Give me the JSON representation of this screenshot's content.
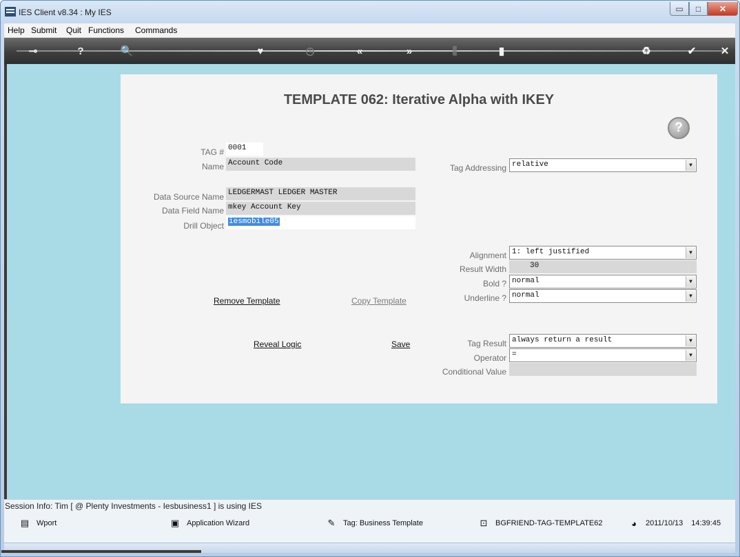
{
  "window": {
    "title": "IES Client v8.34 : My IES",
    "controls": {
      "minimize": "▭",
      "maximize": "□",
      "close": "✕"
    }
  },
  "menu": [
    "Help",
    "Submit",
    "Quit",
    "Functions",
    "Commands"
  ],
  "toolbar": {
    "icons": [
      "key-icon",
      "help-icon",
      "search-icon",
      "heart-icon",
      "clock-icon",
      "rewind-icon",
      "forward-icon",
      "columns-icon",
      "page-icon",
      "recycle-icon",
      "check-icon",
      "close-icon"
    ],
    "glyphs": {
      "key": "⊸",
      "help": "?",
      "search": "🔍",
      "heart": "♥",
      "clock": "◷",
      "rewind": "«",
      "forward": "»",
      "columns": "⫼",
      "page": "▮",
      "recycle": "♻",
      "check": "✔",
      "close": "✕"
    }
  },
  "form": {
    "title": "TEMPLATE 062: Iterative  Alpha with IKEY",
    "help_glyph": "?",
    "tag_label": "TAG #",
    "tag_value": "0001",
    "name_label": "Name",
    "name_value": "Account Code",
    "data_source_label": "Data Source Name",
    "data_source_value": "LEDGERMAST LEDGER MASTER",
    "data_field_label": "Data Field Name",
    "data_field_value": "mkey Account Key",
    "drill_object_label": "Drill Object",
    "drill_object_value": "iesmobile05",
    "tag_addressing_label": "Tag Addressing",
    "tag_addressing_value": "relative",
    "alignment_label": "Alignment",
    "alignment_value": "1: left justified",
    "result_width_label": "Result Width",
    "result_width_value": "30",
    "bold_label": "Bold ?",
    "bold_value": "normal",
    "underline_label": "Underline ?",
    "underline_value": "normal",
    "tag_result_label": "Tag Result",
    "tag_result_value": "always return a result",
    "operator_label": "Operator",
    "operator_value": "=",
    "conditional_value_label": "Conditional Value",
    "conditional_value_value": "",
    "dropdown_arrow": "▼"
  },
  "actions": {
    "remove_template": "Remove Template",
    "copy_template": "Copy Template",
    "reveal_logic": "Reveal Logic",
    "save": "Save"
  },
  "session": {
    "info": "Session Info: Tim [ @ Plenty Investments  - Iesbusiness1 ] is using IES"
  },
  "taskbar": {
    "wport": "Wport",
    "application_wizard": "Application Wizard",
    "tag_business_template": "Tag: Business Template",
    "bgfriend": "BGFRIEND-TAG-TEMPLATE62",
    "date": "2011/10/13",
    "time": "14:39:45",
    "glyphs": {
      "wport": "▤",
      "wizard": "▣",
      "tag": "✎",
      "bgfriend": "⊡",
      "clock": "◕"
    }
  },
  "colors": {
    "client_background": "#a9dbe6",
    "panel_background": "#f4f4f4",
    "toolbar": "#3e3e3e",
    "selection_highlight": "#3e8de0"
  }
}
